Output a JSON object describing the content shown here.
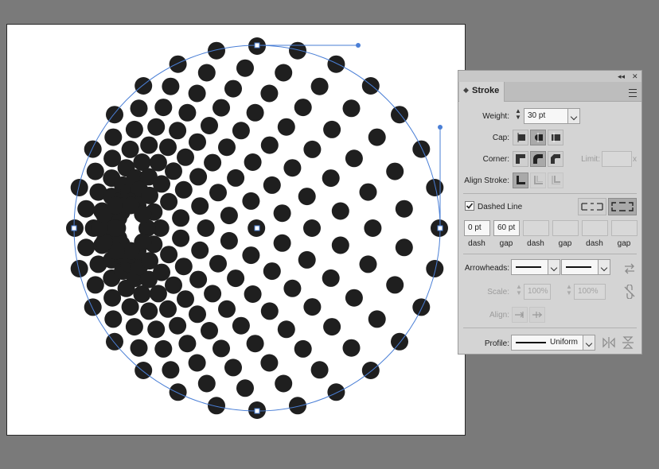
{
  "stroke_panel": {
    "tab_label": "Stroke",
    "collapse_glyph": "◂◂",
    "close_glyph": "✕",
    "weight": {
      "label": "Weight:",
      "value": "30 pt"
    },
    "cap": {
      "label": "Cap:",
      "selected": "round"
    },
    "corner": {
      "label": "Corner:",
      "selected": "round",
      "limit_label": "Limit:",
      "limit_value": "",
      "limit_suffix": "x"
    },
    "align_stroke": {
      "label": "Align Stroke:",
      "selected": "center"
    },
    "dashed_line": {
      "label": "Dashed Line",
      "checked": true
    },
    "dashes": [
      {
        "value": "0 pt",
        "label": "dash"
      },
      {
        "value": "60 pt",
        "label": "gap"
      },
      {
        "value": "",
        "label": "dash"
      },
      {
        "value": "",
        "label": "gap"
      },
      {
        "value": "",
        "label": "dash"
      },
      {
        "value": "",
        "label": "gap"
      }
    ],
    "arrowheads": {
      "label": "Arrowheads:"
    },
    "scale": {
      "label": "Scale:",
      "start": "100%",
      "end": "100%"
    },
    "align": {
      "label": "Align:"
    },
    "profile": {
      "label": "Profile:",
      "value": "Uniform"
    }
  },
  "colors": {
    "path": "#4a7fd6",
    "dots": "#1f1f1f",
    "panel": "#d4d4d4"
  },
  "icons": [
    "weight-spinner-icon",
    "cap-butt-icon",
    "cap-round-icon",
    "cap-projecting-icon",
    "corner-miter-icon",
    "corner-round-icon",
    "corner-bevel-icon",
    "align-center-icon",
    "align-inside-icon",
    "align-outside-icon",
    "checkbox-checked-icon",
    "dash-preserve-icon",
    "dash-align-corners-icon",
    "swap-arrowheads-icon",
    "link-scale-icon",
    "flip-along-icon",
    "flip-across-icon",
    "panel-menu-icon"
  ]
}
